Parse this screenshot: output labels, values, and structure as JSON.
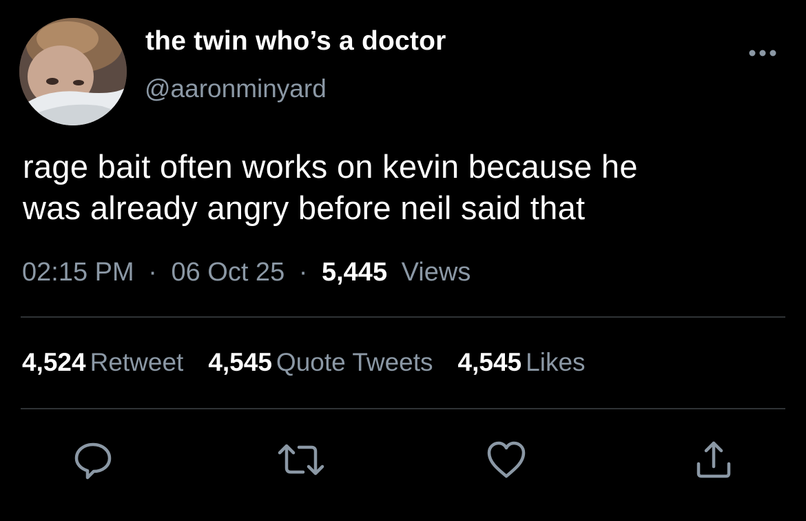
{
  "user": {
    "display_name": "the twin who’s a doctor",
    "handle": "@aaronminyard",
    "avatar_icon": "profile-photo"
  },
  "tweet": {
    "text_lines": [
      "rage bait often works on kevin because he",
      "was already angry before neil said that"
    ],
    "time": "02:15 PM",
    "separator": "·",
    "date": "06 Oct 25",
    "views_count": "5,445",
    "views_label": "Views"
  },
  "stats": {
    "retweets_count": "4,524",
    "retweets_label": "Retweet",
    "quotes_count": "4,545",
    "quotes_label": "Quote Tweets",
    "likes_count": "4,545",
    "likes_label": "Likes"
  },
  "actions": {
    "reply_icon": "reply-icon",
    "retweet_icon": "retweet-icon",
    "like_icon": "heart-icon",
    "share_icon": "share-icon",
    "more_icon": "more-icon"
  },
  "colors": {
    "background": "#000000",
    "primary_text": "#ffffff",
    "secondary_text": "#8b98a5",
    "divider": "#2f3336"
  }
}
